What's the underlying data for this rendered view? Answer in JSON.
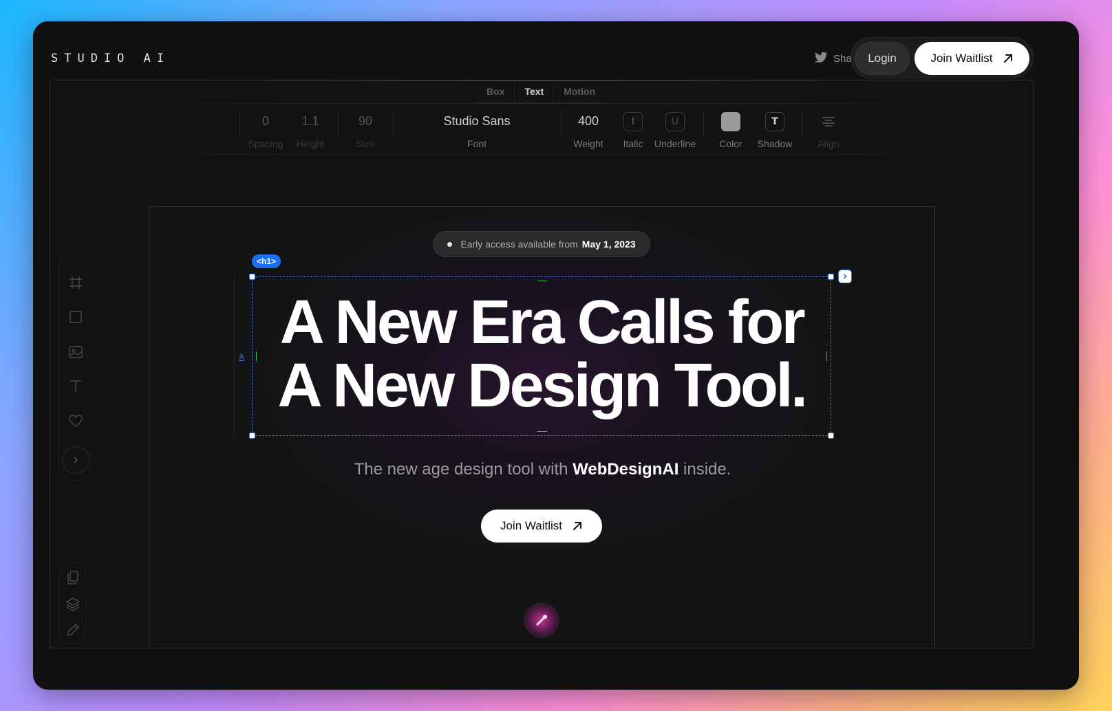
{
  "app": {
    "logo": "STUDIO AI"
  },
  "header": {
    "share_label": "Share",
    "login_label": "Login",
    "join_label": "Join Waitlist"
  },
  "editor": {
    "tabs": [
      {
        "label": "Box"
      },
      {
        "label": "Text"
      },
      {
        "label": "Motion"
      }
    ],
    "active_tab": "Text",
    "properties": {
      "spacing": {
        "value": "0",
        "label": "Spacing"
      },
      "height": {
        "value": "1.1",
        "label": "Height"
      },
      "size": {
        "value": "90",
        "label": "Size"
      },
      "font": {
        "value": "Studio Sans",
        "label": "Font"
      },
      "weight": {
        "value": "400",
        "label": "Weight"
      },
      "italic": {
        "label": "Italic",
        "glyph": "I"
      },
      "underline": {
        "label": "Underline",
        "glyph": "U"
      },
      "color": {
        "label": "Color",
        "swatch": "#9a9a9a"
      },
      "shadow": {
        "label": "Shadow",
        "glyph": "T"
      },
      "align": {
        "label": "Align"
      }
    }
  },
  "canvas": {
    "early_access_text": "Early access available from",
    "early_access_date": "May 1, 2023",
    "selection_tag": "<h1>",
    "side_marker": "A",
    "headline_line1": "A New Era Calls for",
    "headline_line2": "A New Design Tool.",
    "subline_before": "The new age design tool with",
    "subline_brand": "WebDesignAI",
    "subline_after": "inside.",
    "cta_label": "Join Waitlist"
  },
  "colors": {
    "accent_blue": "#1a6ff5",
    "guide_green": "#2fbf4a",
    "window_bg": "#111112"
  }
}
